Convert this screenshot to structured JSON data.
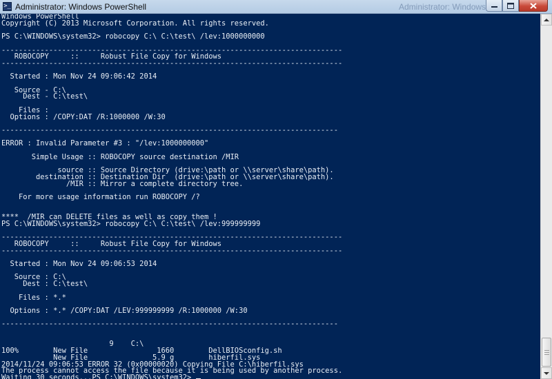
{
  "window": {
    "title": "Administrator: Windows PowerShell",
    "background_title": "Administrator: Windows Pow...",
    "icon": "powershell-icon"
  },
  "controls": {
    "minimize": "minimize-icon",
    "maximize": "maximize-icon",
    "close": "close-icon"
  },
  "colors": {
    "console_background": "#012456",
    "console_text": "#eeedf0"
  },
  "console": {
    "lines": [
      "Windows PowerShell",
      "Copyright (C) 2013 Microsoft Corporation. All rights reserved.",
      "",
      "PS C:\\WINDOWS\\system32> robocopy C:\\ C:\\test\\ /lev:1000000000",
      "",
      "-------------------------------------------------------------------------------",
      "   ROBOCOPY     ::     Robust File Copy for Windows",
      "-------------------------------------------------------------------------------",
      "",
      "  Started : Mon Nov 24 09:06:42 2014",
      "",
      "   Source - C:\\",
      "     Dest - C:\\test\\",
      "",
      "    Files :",
      "  Options : /COPY:DAT /R:1000000 /W:30",
      "",
      "------------------------------------------------------------------------------",
      "",
      "ERROR : Invalid Parameter #3 : \"/lev:1000000000\"",
      "",
      "       Simple Usage :: ROBOCOPY source destination /MIR",
      "",
      "             source :: Source Directory (drive:\\path or \\\\server\\share\\path).",
      "        destination :: Destination Dir  (drive:\\path or \\\\server\\share\\path).",
      "               /MIR :: Mirror a complete directory tree.",
      "",
      "    For more usage information run ROBOCOPY /?",
      "",
      "",
      "****  /MIR can DELETE files as well as copy them !",
      "PS C:\\WINDOWS\\system32> robocopy C:\\ C:\\test\\ /lev:999999999",
      "",
      "-------------------------------------------------------------------------------",
      "   ROBOCOPY     ::     Robust File Copy for Windows",
      "-------------------------------------------------------------------------------",
      "",
      "  Started : Mon Nov 24 09:06:53 2014",
      "",
      "   Source : C:\\",
      "     Dest : C:\\test\\",
      "",
      "    Files : *.*",
      "",
      "  Options : *.* /COPY:DAT /LEV:999999999 /R:1000000 /W:30",
      "",
      "------------------------------------------------------------------------------",
      "",
      "",
      "                         9    C:\\",
      "100%        New File                1660        DellBIOSconfig.sh",
      "            New File               5.9 g        hiberfil.sys",
      "2014/11/24 09:06:53 ERROR 32 (0x00000020) Copying File C:\\hiberfil.sys",
      "The process cannot access the file because it is being used by another process.",
      "Waiting 30 seconds...PS C:\\WINDOWS\\system32> "
    ]
  }
}
